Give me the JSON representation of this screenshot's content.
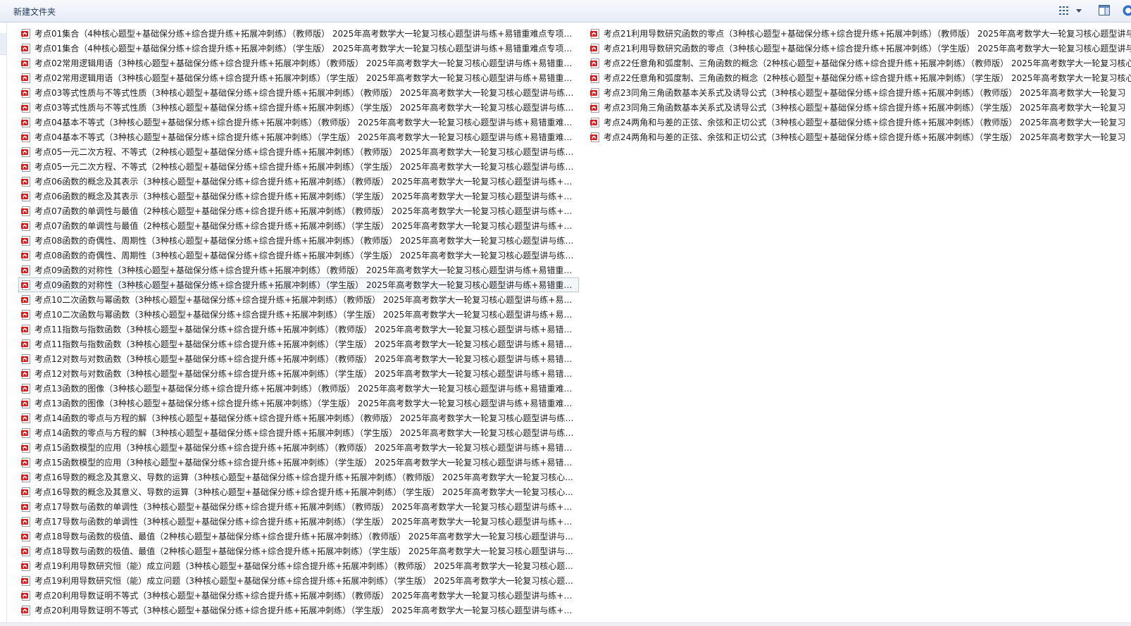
{
  "toolbar": {
    "new_folder_label": "新建文件夹",
    "view_icon": "view-options-icon",
    "view_menu_icon": "chevron-down-icon",
    "preview_pane_icon": "preview-pane-icon",
    "help_icon": "help-icon"
  },
  "file_icon": "pdf-file-icon",
  "colors": {
    "pdf_red": "#d11f1f",
    "toolbar_top": "#f7f9fc",
    "toolbar_bottom": "#e6ecf5",
    "focus_border": "#7da2ce"
  },
  "files_left": [
    "考点01集合（4种核心题型+基础保分练+综合提升练+拓展冲刺练）（教师版） 2025年高考数学大一轮复习核心题型讲与练+易错重难点专项突...",
    "考点01集合（4种核心题型+基础保分练+综合提升练+拓展冲刺练）（学生版） 2025年高考数学大一轮复习核心题型讲与练+易错重难点专项突...",
    "考点02常用逻辑用语（3种核心题型+基础保分练+综合提升练+拓展冲刺练）（教师版） 2025年高考数学大一轮复习核心题型讲与练+易错重难...",
    "考点02常用逻辑用语（3种核心题型+基础保分练+综合提升练+拓展冲刺练）（学生版） 2025年高考数学大一轮复习核心题型讲与练+易错重难...",
    "考点03等式性质与不等式性质（3种核心题型+基础保分练+综合提升练+拓展冲刺练）（教师版） 2025年高考数学大一轮复习核心题型讲与练+...",
    "考点03等式性质与不等式性质（3种核心题型+基础保分练+综合提升练+拓展冲刺练）（学生版） 2025年高考数学大一轮复习核心题型讲与练+...",
    "考点04基本不等式（3种核心题型+基础保分练+综合提升练+拓展冲刺练）（教师版） 2025年高考数学大一轮复习核心题型讲与练+易错重难点...",
    "考点04基本不等式（3种核心题型+基础保分练+综合提升练+拓展冲刺练）（学生版） 2025年高考数学大一轮复习核心题型讲与练+易错重难点...",
    "考点05一元二次方程、不等式（2种核心题型+基础保分练+综合提升练+拓展冲刺练）（教师版） 2025年高考数学大一轮复习核心题型讲与练+...",
    "考点05一元二次方程、不等式（2种核心题型+基础保分练+综合提升练+拓展冲刺练）（学生版） 2025年高考数学大一轮复习核心题型讲与练+...",
    "考点06函数的概念及其表示（3种核心题型+基础保分练+综合提升练+拓展冲刺练）（教师版） 2025年高考数学大一轮复习核心题型讲与练+易...",
    "考点06函数的概念及其表示（3种核心题型+基础保分练+综合提升练+拓展冲刺练）（学生版） 2025年高考数学大一轮复习核心题型讲与练+易...",
    "考点07函数的单调性与最值（2种核心题型+基础保分练+综合提升练+拓展冲刺练）（教师版） 2025年高考数学大一轮复习核心题型讲与练+易...",
    "考点07函数的单调性与最值（2种核心题型+基础保分练+综合提升练+拓展冲刺练）（学生版） 2025年高考数学大一轮复习核心题型讲与练+易...",
    "考点08函数的奇偶性、周期性（3种核心题型+基础保分练+综合提升练+拓展冲刺练）（教师版） 2025年高考数学大一轮复习核心题型讲与练+...",
    "考点08函数的奇偶性、周期性（3种核心题型+基础保分练+综合提升练+拓展冲刺练）（学生版） 2025年高考数学大一轮复习核心题型讲与练+...",
    "考点09函数的对称性（3种核心题型+基础保分练+综合提升练+拓展冲刺练）（教师版） 2025年高考数学大一轮复习核心题型讲与练+易错重难...",
    "考点09函数的对称性（3种核心题型+基础保分练+综合提升练+拓展冲刺练）（学生版） 2025年高考数学大一轮复习核心题型讲与练+易错重难...",
    "考点10二次函数与幂函数（3种核心题型+基础保分练+综合提升练+拓展冲刺练）（教师版） 2025年高考数学大一轮复习核心题型讲与练+易错...",
    "考点10二次函数与幂函数（3种核心题型+基础保分练+综合提升练+拓展冲刺练）（学生版） 2025年高考数学大一轮复习核心题型讲与练+易错...",
    "考点11指数与指数函数（3种核心题型+基础保分练+综合提升练+拓展冲刺练）（教师版） 2025年高考数学大一轮复习核心题型讲与练+易错重...",
    "考点11指数与指数函数（3种核心题型+基础保分练+综合提升练+拓展冲刺练）（学生版） 2025年高考数学大一轮复习核心题型讲与练+易错重...",
    "考点12对数与对数函数（3种核心题型+基础保分练+综合提升练+拓展冲刺练）（教师版） 2025年高考数学大一轮复习核心题型讲与练+易错重...",
    "考点12对数与对数函数（3种核心题型+基础保分练+综合提升练+拓展冲刺练）（学生版） 2025年高考数学大一轮复习核心题型讲与练+易错重...",
    "考点13函数的图像（3种核心题型+基础保分练+综合提升练+拓展冲刺练）（教师版） 2025年高考数学大一轮复习核心题型讲与练+易错重难点...",
    "考点13函数的图像（3种核心题型+基础保分练+综合提升练+拓展冲刺练）（学生版） 2025年高考数学大一轮复习核心题型讲与练+易错重难点...",
    "考点14函数的零点与方程的解（3种核心题型+基础保分练+综合提升练+拓展冲刺练）（教师版） 2025年高考数学大一轮复习核心题型讲与练+...",
    "考点14函数的零点与方程的解（3种核心题型+基础保分练+综合提升练+拓展冲刺练）（学生版） 2025年高考数学大一轮复习核心题型讲与练+...",
    "考点15函数模型的应用（3种核心题型+基础保分练+综合提升练+拓展冲刺练）（教师版） 2025年高考数学大一轮复习核心题型讲与练+易错重...",
    "考点15函数模型的应用（3种核心题型+基础保分练+综合提升练+拓展冲刺练）（学生版） 2025年高考数学大一轮复习核心题型讲与练+易错重...",
    "考点16导数的概念及其意义、导数的运算（3种核心题型+基础保分练+综合提升练+拓展冲刺练）（教师版） 2025年高考数学大一轮复习核心...",
    "考点16导数的概念及其意义、导数的运算（3种核心题型+基础保分练+综合提升练+拓展冲刺练）（学生版） 2025年高考数学大一轮复习核心...",
    "考点17导数与函数的单调性（3种核心题型+基础保分练+综合提升练+拓展冲刺练）（教师版） 2025年高考数学大一轮复习核心题型讲与练+易...",
    "考点17导数与函数的单调性（3种核心题型+基础保分练+综合提升练+拓展冲刺练）（学生版） 2025年高考数学大一轮复习核心题型讲与练+易...",
    "考点18导数与函数的极值、最值（2种核心题型+基础保分练+综合提升练+拓展冲刺练）（教师版） 2025年高考数学大一轮复习核心题型讲与...",
    "考点18导数与函数的极值、最值（2种核心题型+基础保分练+综合提升练+拓展冲刺练）（学生版） 2025年高考数学大一轮复习核心题型讲与...",
    "考点19利用导数研究恒（能）成立问题（3种核心题型+基础保分练+综合提升练+拓展冲刺练）（教师版） 2025年高考数学大一轮复习核心题...",
    "考点19利用导数研究恒（能）成立问题（3种核心题型+基础保分练+综合提升练+拓展冲刺练）（学生版） 2025年高考数学大一轮复习核心题...",
    "考点20利用导数证明不等式（3种核心题型+基础保分练+综合提升练+拓展冲刺练）（教师版） 2025年高考数学大一轮复习核心题型讲与练+易...",
    "考点20利用导数证明不等式（3种核心题型+基础保分练+综合提升练+拓展冲刺练）（学生版） 2025年高考数学大一轮复习核心题型讲与练+易..."
  ],
  "files_right": [
    "考点21利用导数研究函数的零点（3种核心题型+基础保分练+综合提升练+拓展冲刺练）（教师版） 2025年高考数学大一轮复习核心题型讲与",
    "考点21利用导数研究函数的零点（3种核心题型+基础保分练+综合提升练+拓展冲刺练）（学生版） 2025年高考数学大一轮复习核心题型讲与",
    "考点22任意角和弧度制、三角函数的概念（2种核心题型+基础保分练+综合提升练+拓展冲刺练）（教师版） 2025年高考数学大一轮复习核心",
    "考点22任意角和弧度制、三角函数的概念（2种核心题型+基础保分练+综合提升练+拓展冲刺练）（学生版） 2025年高考数学大一轮复习核心",
    "考点23同角三角函数基本关系式及诱导公式（3种核心题型+基础保分练+综合提升练+拓展冲刺练）（教师版） 2025年高考数学大一轮复习",
    "考点23同角三角函数基本关系式及诱导公式（3种核心题型+基础保分练+综合提升练+拓展冲刺练）（学生版） 2025年高考数学大一轮复习",
    "考点24两角和与差的正弦、余弦和正切公式（3种核心题型+基础保分练+综合提升练+拓展冲刺练）（教师版） 2025年高考数学大一轮复习",
    "考点24两角和与差的正弦、余弦和正切公式（3种核心题型+基础保分练+综合提升练+拓展冲刺练）（学生版） 2025年高考数学大一轮复习"
  ],
  "focused_left_index": 17
}
